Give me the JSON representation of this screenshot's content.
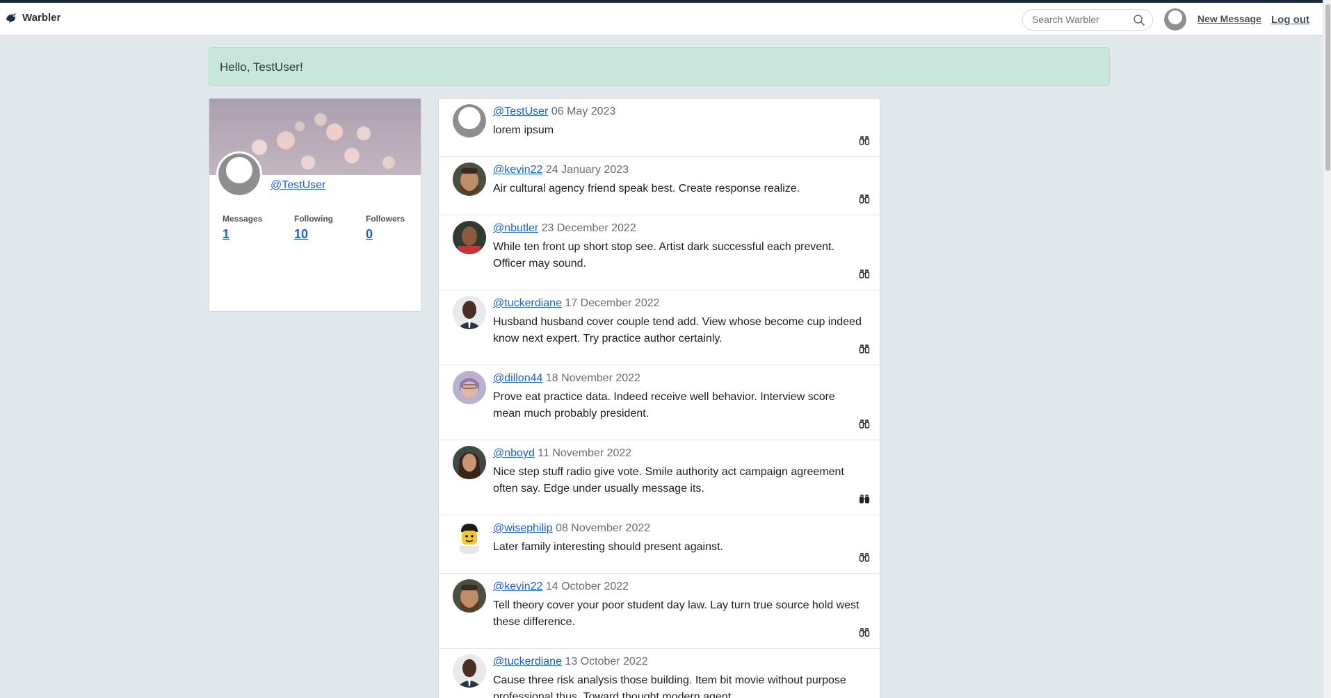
{
  "nav": {
    "brand": "Warbler",
    "search_placeholder": "Search Warbler",
    "new_message": "New Message",
    "logout": "Log out"
  },
  "alert": {
    "text": "Hello, TestUser!"
  },
  "profile": {
    "handle": "@TestUser",
    "stats": [
      {
        "label": "Messages",
        "value": "1"
      },
      {
        "label": "Following",
        "value": "10"
      },
      {
        "label": "Followers",
        "value": "0"
      }
    ]
  },
  "messages": [
    {
      "user": "@TestUser",
      "date": "06 May 2023",
      "text": "lorem ipsum",
      "liked": false,
      "avatar": "default-avatar"
    },
    {
      "user": "@kevin22",
      "date": "24 January 2023",
      "text": "Air cultural agency friend speak best. Create response realize.",
      "liked": false,
      "avatar": "user-photo"
    },
    {
      "user": "@nbutler",
      "date": "23 December 2022",
      "text": "While ten front up short stop see. Artist dark successful each prevent. Officer may sound.",
      "liked": false,
      "avatar": "user-photo"
    },
    {
      "user": "@tuckerdiane",
      "date": "17 December 2022",
      "text": "Husband husband cover couple tend add. View whose become cup indeed know next expert. Try practice author certainly.",
      "liked": false,
      "avatar": "user-photo"
    },
    {
      "user": "@dillon44",
      "date": "18 November 2022",
      "text": "Prove eat practice data. Indeed receive well behavior. Interview score mean much probably president.",
      "liked": false,
      "avatar": "user-photo"
    },
    {
      "user": "@nboyd",
      "date": "11 November 2022",
      "text": "Nice step stuff radio give vote. Smile authority act campaign agreement often say. Edge under usually message its.",
      "liked": true,
      "avatar": "user-photo"
    },
    {
      "user": "@wisephilip",
      "date": "08 November 2022",
      "text": "Later family interesting should present against.",
      "liked": false,
      "avatar": "lego-figure"
    },
    {
      "user": "@kevin22",
      "date": "14 October 2022",
      "text": "Tell theory cover your poor student day law. Lay turn true source hold west these difference.",
      "liked": false,
      "avatar": "user-photo"
    },
    {
      "user": "@tuckerdiane",
      "date": "13 October 2022",
      "text": "Cause three risk analysis those building. Item bit movie without purpose professional thus. Toward thought modern agent.",
      "liked": false,
      "avatar": "user-photo"
    }
  ]
}
